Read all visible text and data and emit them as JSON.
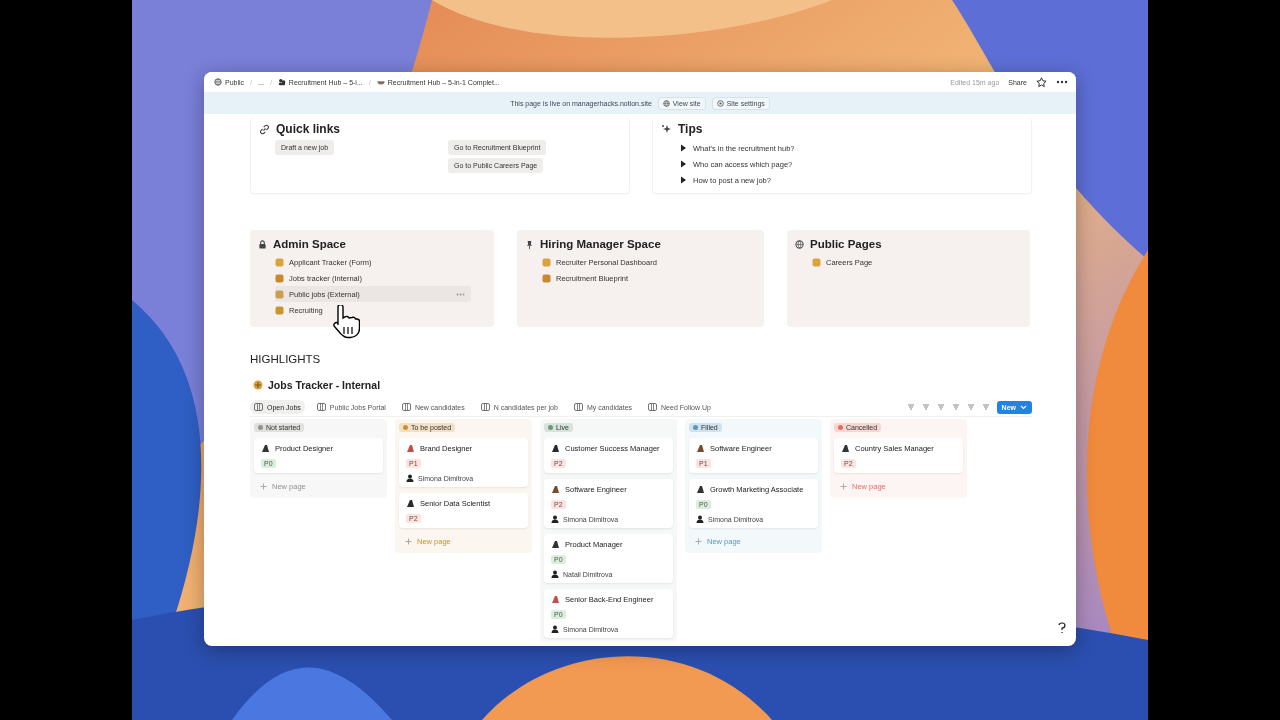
{
  "topbar": {
    "breadcrumbs": [
      {
        "label": "Public"
      },
      {
        "label": "..."
      },
      {
        "label": "Recruitment Hub – 5-i..."
      },
      {
        "label": "Recruitment Hub – 5-in-1 Complet..."
      }
    ],
    "separator": "/",
    "edited": "Edited 15m ago",
    "share": "Share"
  },
  "banner": {
    "text": "This page is live on managerhacks.notion.site",
    "buttons": [
      {
        "label": "View site"
      },
      {
        "label": "Site settings"
      }
    ]
  },
  "quick_links": {
    "title": "Quick links",
    "buttons": [
      {
        "label": "Draft a new job"
      },
      {
        "label": "Go to Recruitment Blueprint"
      },
      {
        "label": "Go to Public Careers Page"
      }
    ]
  },
  "tips": {
    "title": "Tips",
    "items": [
      {
        "label": "What's in the recruitment hub?",
        "expanded": false
      },
      {
        "label": "Who can access which page?",
        "expanded": false
      },
      {
        "label": "How to post a new job?",
        "expanded": false
      }
    ]
  },
  "spaces": [
    {
      "title": "Admin Space",
      "items": [
        {
          "label": "Applicant Tracker (Form)",
          "hovered": false
        },
        {
          "label": "Jobs tracker (Internal)",
          "hovered": false
        },
        {
          "label": "Public jobs (External)",
          "hovered": true
        },
        {
          "label": "Recruiting",
          "hovered": false
        }
      ]
    },
    {
      "title": "Hiring Manager Space",
      "items": [
        {
          "label": "Recruiter Personal Dashboard",
          "hovered": false
        },
        {
          "label": "Recruitment Blueprint",
          "hovered": false
        }
      ]
    },
    {
      "title": "Public Pages",
      "items": [
        {
          "label": "Careers Page",
          "hovered": false
        }
      ]
    }
  ],
  "highlights": "HIGHLIGHTS",
  "database": {
    "title": "Jobs Tracker - Internal",
    "views": [
      {
        "label": "Open Jobs",
        "selected": true
      },
      {
        "label": "Public Jobs Portal",
        "selected": false
      },
      {
        "label": "New candidates",
        "selected": false
      },
      {
        "label": "N candidates per job",
        "selected": false
      },
      {
        "label": "My candidates",
        "selected": false
      },
      {
        "label": "Need Follow Up",
        "selected": false
      }
    ],
    "new_button": "New"
  },
  "board": [
    {
      "status": "Not started",
      "color": "#91918e",
      "cards": [
        {
          "title": "Product Designer",
          "priority": "P0",
          "color": "#dbeddb"
        }
      ],
      "new_page": "New page"
    },
    {
      "status": "To be posted",
      "color": "#cb912f",
      "cards": [
        {
          "title": "Brand Designer",
          "priority": "P1",
          "color": "#ffe2dd",
          "assignee": "Simona Dimitrova"
        },
        {
          "title": "Senior Data Scientist",
          "priority": "P2",
          "color": "#ffe2dd"
        }
      ],
      "new_page": "New page"
    },
    {
      "status": "Live",
      "color": "#6c9b7d",
      "cards": [
        {
          "title": "Customer Success Manager",
          "priority": "P2",
          "color": "#ffe2dd"
        },
        {
          "title": "Software Engineer",
          "priority": "P2",
          "color": "#ffe2dd",
          "assignee": "Simona Dimitrova"
        },
        {
          "title": "Product Manager",
          "priority": "P0",
          "color": "#dbeddb",
          "assignee": "Natali Dimitrova"
        },
        {
          "title": "Senior Back-End Engineer",
          "priority": "P0",
          "color": "#dbeddb",
          "assignee": "Simona Dimitrova"
        }
      ]
    },
    {
      "status": "Filled",
      "color": "#5b97bd",
      "cards": [
        {
          "title": "Software Engineer",
          "priority": "P1",
          "color": "#ffe2dd"
        },
        {
          "title": "Growth Marketing Associate",
          "priority": "P0",
          "color": "#dbeddb",
          "assignee": "Simona Dimitrova"
        }
      ],
      "new_page": "New page"
    },
    {
      "status": "Cancelled",
      "color": "#e16f64",
      "cards": [
        {
          "title": "Country Sales Manager",
          "priority": "P2",
          "color": "#ffe2dd"
        }
      ],
      "new_page": "New page"
    }
  ]
}
